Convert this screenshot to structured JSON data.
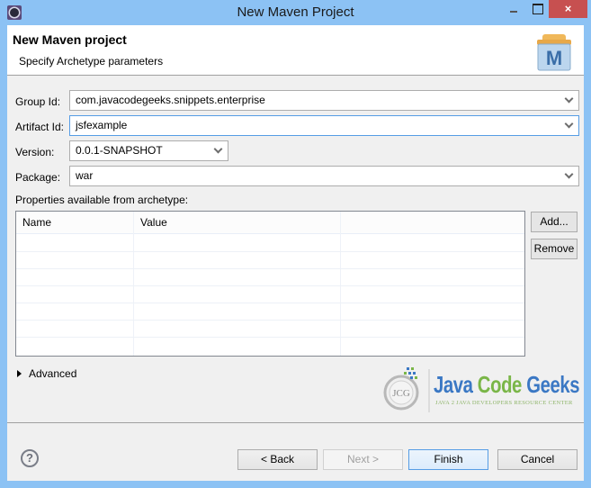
{
  "window": {
    "title": "New Maven Project",
    "app_icon": "eclipse-gear-icon",
    "controls": {
      "minimize": "minimize-icon",
      "maximize": "maximize-icon",
      "close": "×"
    }
  },
  "banner": {
    "title": "New Maven project",
    "subtitle": "Specify Archetype parameters",
    "icon": "maven-m-icon",
    "icon_letter": "M"
  },
  "form": {
    "group_id": {
      "label": "Group Id:",
      "value": "com.javacodegeeks.snippets.enterprise"
    },
    "artifact_id": {
      "label": "Artifact Id:",
      "value": "jsfexample"
    },
    "version": {
      "label": "Version:",
      "value": "0.0.1-SNAPSHOT"
    },
    "package": {
      "label": "Package:",
      "value": "war"
    }
  },
  "properties": {
    "label": "Properties available from archetype:",
    "columns": [
      "Name",
      "Value",
      ""
    ],
    "rows": [],
    "add_label": "Add...",
    "remove_label": "Remove"
  },
  "advanced": {
    "label": "Advanced",
    "expanded": false
  },
  "logo": {
    "java": "Java",
    "code": "Code",
    "geeks": "Geeks",
    "tagline": "JAVA 2 JAVA DEVELOPERS RESOURCE CENTER",
    "badge": "JCG",
    "colors": {
      "blue": "#3b78c4",
      "green": "#7ab648"
    }
  },
  "footer": {
    "help_icon": "?",
    "back_label": "< Back",
    "next_label": "Next >",
    "finish_label": "Finish",
    "cancel_label": "Cancel"
  }
}
